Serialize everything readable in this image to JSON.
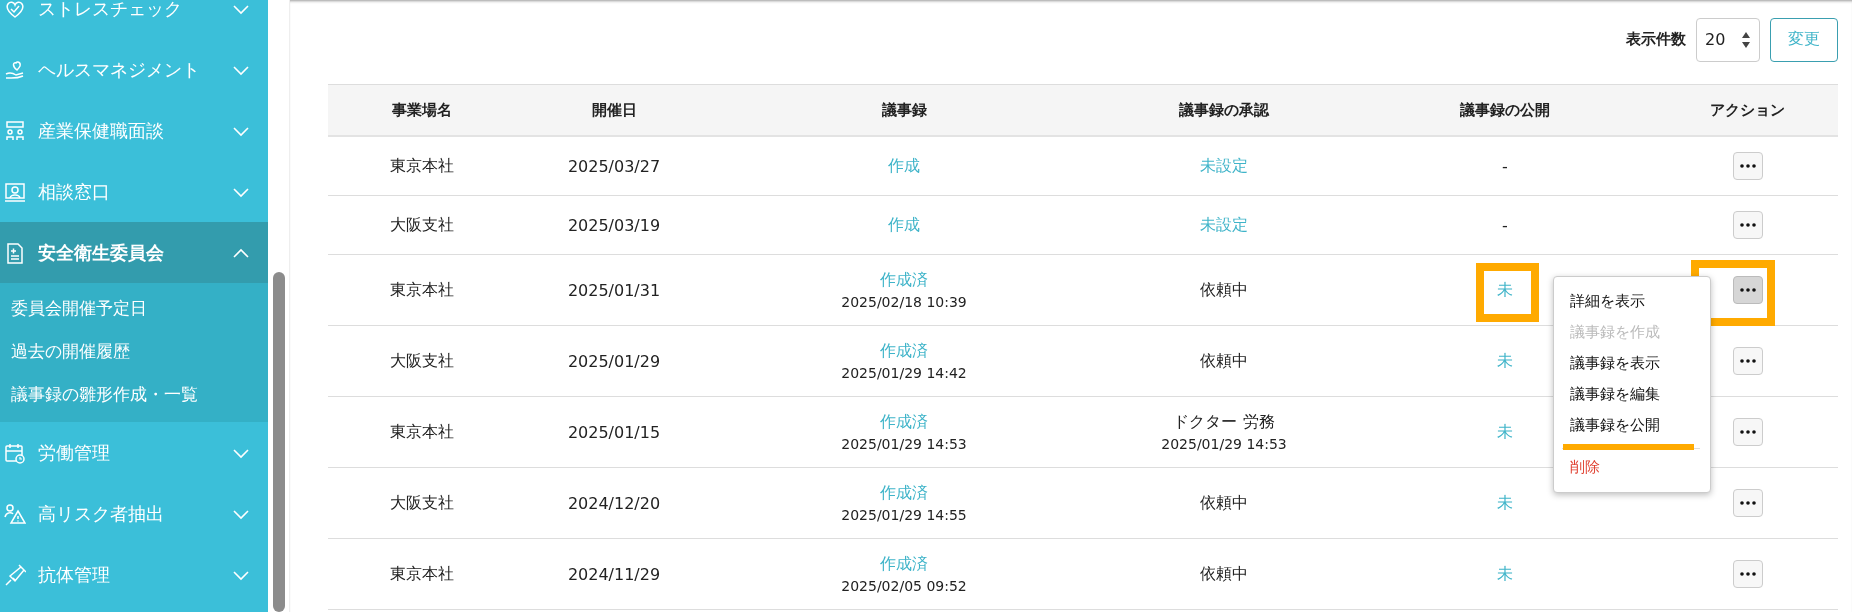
{
  "sidebar": {
    "items": [
      {
        "label": "ストレスチェック",
        "selected": false,
        "expanded": false
      },
      {
        "label": "ヘルスマネジメント",
        "selected": false,
        "expanded": false
      },
      {
        "label": "産業保健職面談",
        "selected": false,
        "expanded": false
      },
      {
        "label": "相談窓口",
        "selected": false,
        "expanded": false
      },
      {
        "label": "安全衛生委員会",
        "selected": true,
        "expanded": true,
        "children": [
          {
            "label": "委員会開催予定日"
          },
          {
            "label": "過去の開催履歴"
          },
          {
            "label": "議事録の雛形作成・一覧"
          }
        ]
      },
      {
        "label": "労働管理",
        "selected": false,
        "expanded": false
      },
      {
        "label": "高リスク者抽出",
        "selected": false,
        "expanded": false
      },
      {
        "label": "抗体管理",
        "selected": false,
        "expanded": false
      }
    ]
  },
  "toolbar": {
    "page_size_label": "表示件数",
    "page_size": "20",
    "apply_button": "変更"
  },
  "table": {
    "columns": [
      "事業場名",
      "開催日",
      "議事録",
      "議事録の承認",
      "議事録の公開",
      "アクション"
    ],
    "rows": [
      {
        "site": "東京本社",
        "date": "2025/03/27",
        "minutes": {
          "text": "作成",
          "link": true
        },
        "approval": {
          "text": "未設定",
          "link": true
        },
        "publish": {
          "text": "-",
          "link": false
        },
        "action_active": false
      },
      {
        "site": "大阪支社",
        "date": "2025/03/19",
        "minutes": {
          "text": "作成",
          "link": true
        },
        "approval": {
          "text": "未設定",
          "link": true
        },
        "publish": {
          "text": "-",
          "link": false
        },
        "action_active": false
      },
      {
        "site": "東京本社",
        "date": "2025/01/31",
        "minutes": {
          "text": "作成済",
          "link": true,
          "sub": "2025/02/18 10:39"
        },
        "approval": {
          "text": "依頼中",
          "link": false
        },
        "publish": {
          "text": "未",
          "link": true
        },
        "action_active": true
      },
      {
        "site": "大阪支社",
        "date": "2025/01/29",
        "minutes": {
          "text": "作成済",
          "link": true,
          "sub": "2025/01/29 14:42"
        },
        "approval": {
          "text": "依頼中",
          "link": false
        },
        "publish": {
          "text": "未",
          "link": true
        },
        "action_active": false
      },
      {
        "site": "東京本社",
        "date": "2025/01/15",
        "minutes": {
          "text": "作成済",
          "link": true,
          "sub": "2025/01/29 14:53"
        },
        "approval": {
          "text": "ドクター 労務",
          "link": false,
          "sub": "2025/01/29 14:53"
        },
        "publish": {
          "text": "未",
          "link": true
        },
        "action_active": false
      },
      {
        "site": "大阪支社",
        "date": "2024/12/20",
        "minutes": {
          "text": "作成済",
          "link": true,
          "sub": "2025/01/29 14:55"
        },
        "approval": {
          "text": "依頼中",
          "link": false
        },
        "publish": {
          "text": "未",
          "link": true
        },
        "action_active": false
      },
      {
        "site": "東京本社",
        "date": "2024/11/29",
        "minutes": {
          "text": "作成済",
          "link": true,
          "sub": "2025/02/05 09:52"
        },
        "approval": {
          "text": "依頼中",
          "link": false
        },
        "publish": {
          "text": "未",
          "link": true
        },
        "action_active": false
      }
    ]
  },
  "action_menu": {
    "items": [
      {
        "label": "詳細を表示",
        "kind": "normal",
        "disabled": false
      },
      {
        "label": "議事録を作成",
        "kind": "normal",
        "disabled": true
      },
      {
        "label": "議事録を表示",
        "kind": "normal",
        "disabled": false
      },
      {
        "label": "議事録を編集",
        "kind": "normal",
        "disabled": false
      },
      {
        "label": "議事録を公開",
        "kind": "normal",
        "disabled": false
      },
      {
        "label": "削除",
        "kind": "danger",
        "disabled": false
      }
    ]
  }
}
